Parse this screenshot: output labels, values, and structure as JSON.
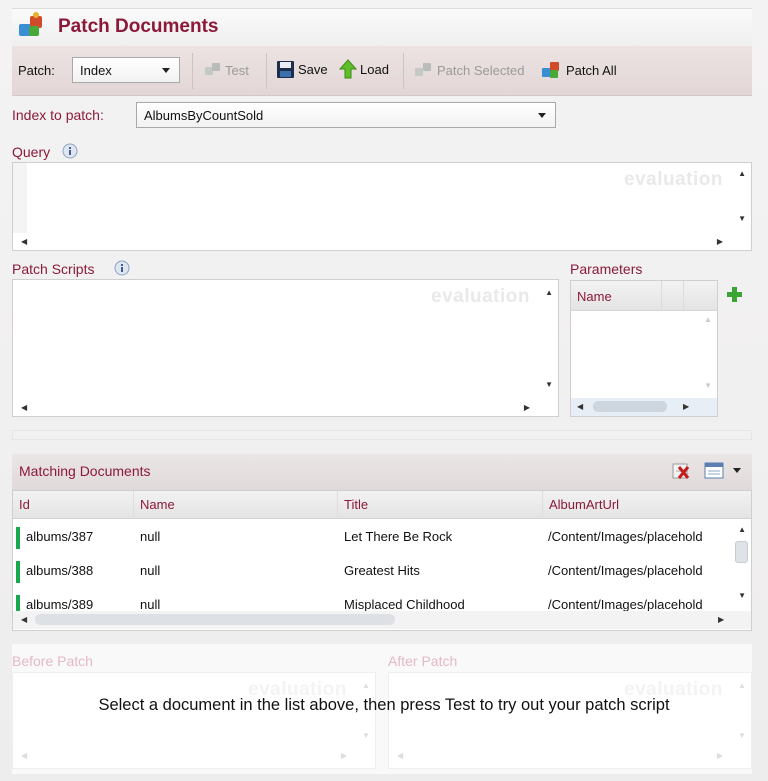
{
  "header": {
    "title": "Patch Documents"
  },
  "toolbar": {
    "patch_label": "Patch:",
    "patch_value": "Index",
    "test_label": "Test",
    "save_label": "Save",
    "load_label": "Load",
    "patch_selected_label": "Patch Selected",
    "patch_all_label": "Patch All"
  },
  "index": {
    "label": "Index to patch:",
    "value": "AlbumsByCountSold"
  },
  "query": {
    "label": "Query",
    "watermark": "evaluation"
  },
  "patch_scripts": {
    "label": "Patch Scripts",
    "watermark": "evaluation"
  },
  "parameters": {
    "label": "Parameters",
    "column_name": "Name"
  },
  "matching": {
    "title": "Matching Documents",
    "columns": [
      "Id",
      "Name",
      "Title",
      "AlbumArtUrl"
    ],
    "rows": [
      {
        "id": "albums/387",
        "name": "null",
        "title": "Let There Be Rock",
        "url": "/Content/Images/placehold"
      },
      {
        "id": "albums/388",
        "name": "null",
        "title": "Greatest Hits",
        "url": "/Content/Images/placehold"
      },
      {
        "id": "albums/389",
        "name": "null",
        "title": "Misplaced Childhood",
        "url": "/Content/Images/placehold"
      }
    ],
    "status_color": "#1aa84e"
  },
  "before": {
    "label": "Before Patch",
    "watermark": "evaluation"
  },
  "after": {
    "label": "After Patch",
    "watermark": "evaluation"
  },
  "hint": "Select a document in the list above, then press Test to try out your patch script",
  "colors": {
    "accent": "#8b1a3a",
    "toolbar_bg": "#e6dada"
  }
}
